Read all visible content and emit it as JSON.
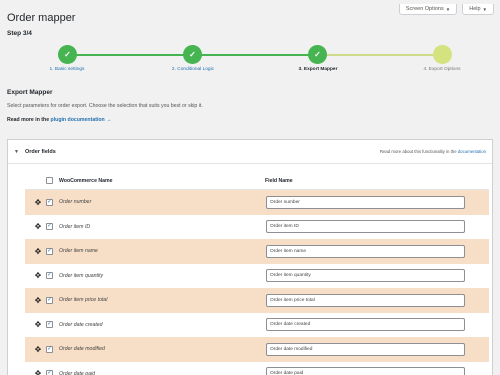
{
  "screen_meta": {
    "screen_options": "Screen Options",
    "help": "Help"
  },
  "page": {
    "title": "Order mapper",
    "step": "Step 3/4"
  },
  "steps": [
    {
      "num": "1",
      "label": "1. Basic settings",
      "state": "done"
    },
    {
      "num": "2",
      "label": "2. Conditional Logic",
      "state": "done"
    },
    {
      "num": "3",
      "label": "3. Export Mapper",
      "state": "current"
    },
    {
      "num": "4",
      "label": "4. Export Options",
      "state": "todo"
    }
  ],
  "export_mapper": {
    "title": "Export Mapper",
    "description": "Select parameters for order export. Choose the selection that suits you best or skip it.",
    "read_more_prefix": "Read more in the",
    "read_more_link": "plugin documentation",
    "read_more_suffix": "→"
  },
  "panel": {
    "title": "Order fields",
    "note_prefix": "Read more about this functionality in the",
    "note_link": "documentation"
  },
  "table": {
    "col_woo": "WooCommerce Name",
    "col_field": "Field Name",
    "rows": [
      {
        "woo": "Order number",
        "field": "Order number",
        "checked": true
      },
      {
        "woo": "Order item ID",
        "field": "Order item ID",
        "checked": true
      },
      {
        "woo": "Order item name",
        "field": "Order item name",
        "checked": true
      },
      {
        "woo": "Order item quantity",
        "field": "Order item quantity",
        "checked": true
      },
      {
        "woo": "Order item price total",
        "field": "Order item price total",
        "checked": true
      },
      {
        "woo": "Order date created",
        "field": "Order date created",
        "checked": true
      },
      {
        "woo": "Order date modified",
        "field": "Order date modified",
        "checked": true
      },
      {
        "woo": "Order date paid",
        "field": "Order date paid",
        "checked": true
      }
    ]
  },
  "colors": {
    "done": "#46b450",
    "todo": "#d5e280",
    "link": "#2271b1",
    "row_highlight": "#f7dfc7"
  },
  "icons": {
    "check": "check-icon",
    "drag": "drag-handle-icon",
    "caret": "caret-down-icon"
  }
}
